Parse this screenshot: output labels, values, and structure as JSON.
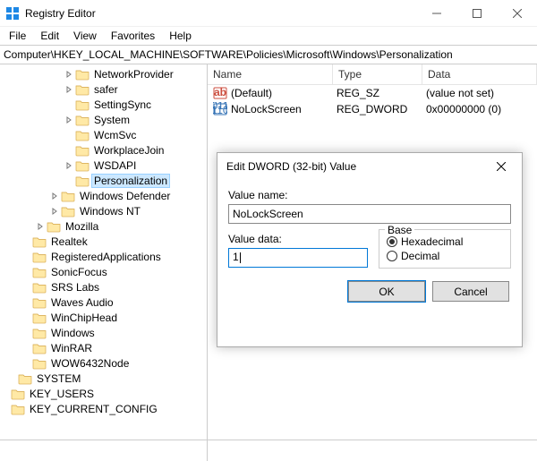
{
  "window": {
    "title": "Registry Editor",
    "menu": [
      "File",
      "Edit",
      "View",
      "Favorites",
      "Help"
    ],
    "controls": {
      "min": "min",
      "max": "max",
      "close": "close"
    }
  },
  "addressbar": {
    "path": "Computer\\HKEY_LOCAL_MACHINE\\SOFTWARE\\Policies\\Microsoft\\Windows\\Personalization"
  },
  "tree": [
    {
      "indent": 3,
      "exp": "closed",
      "label": "NetworkProvider"
    },
    {
      "indent": 3,
      "exp": "closed",
      "label": "safer"
    },
    {
      "indent": 3,
      "exp": "",
      "label": "SettingSync"
    },
    {
      "indent": 3,
      "exp": "closed",
      "label": "System"
    },
    {
      "indent": 3,
      "exp": "",
      "label": "WcmSvc"
    },
    {
      "indent": 3,
      "exp": "",
      "label": "WorkplaceJoin"
    },
    {
      "indent": 3,
      "exp": "closed",
      "label": "WSDAPI"
    },
    {
      "indent": 3,
      "exp": "",
      "label": "Personalization",
      "selected": true
    },
    {
      "indent": 2,
      "exp": "closed",
      "label": "Windows Defender"
    },
    {
      "indent": 2,
      "exp": "closed",
      "label": "Windows NT"
    },
    {
      "indent": 1,
      "exp": "closed",
      "label": "Mozilla"
    },
    {
      "indent": 0,
      "exp": "",
      "label": "Realtek"
    },
    {
      "indent": 0,
      "exp": "",
      "label": "RegisteredApplications"
    },
    {
      "indent": 0,
      "exp": "",
      "label": "SonicFocus"
    },
    {
      "indent": 0,
      "exp": "",
      "label": "SRS Labs"
    },
    {
      "indent": 0,
      "exp": "",
      "label": "Waves Audio"
    },
    {
      "indent": 0,
      "exp": "",
      "label": "WinChipHead"
    },
    {
      "indent": 0,
      "exp": "",
      "label": "Windows"
    },
    {
      "indent": 0,
      "exp": "",
      "label": "WinRAR"
    },
    {
      "indent": 0,
      "exp": "",
      "label": "WOW6432Node"
    },
    {
      "indent": -1,
      "exp": "",
      "label": "SYSTEM"
    },
    {
      "indent": -2,
      "exp": "",
      "label": "KEY_USERS"
    },
    {
      "indent": -2,
      "exp": "",
      "label": "KEY_CURRENT_CONFIG"
    }
  ],
  "list": {
    "headers": {
      "name": "Name",
      "type": "Type",
      "data": "Data"
    },
    "rows": [
      {
        "icon": "string",
        "name": "(Default)",
        "type": "REG_SZ",
        "data": "(value not set)"
      },
      {
        "icon": "binary",
        "name": "NoLockScreen",
        "type": "REG_DWORD",
        "data": "0x00000000 (0)"
      }
    ]
  },
  "dialog": {
    "title": "Edit DWORD (32-bit) Value",
    "value_name_label": "Value name:",
    "value_name": "NoLockScreen",
    "value_data_label": "Value data:",
    "value_data": "1",
    "base_label": "Base",
    "hex_label": "Hexadecimal",
    "dec_label": "Decimal",
    "base": "hex",
    "ok": "OK",
    "cancel": "Cancel"
  }
}
